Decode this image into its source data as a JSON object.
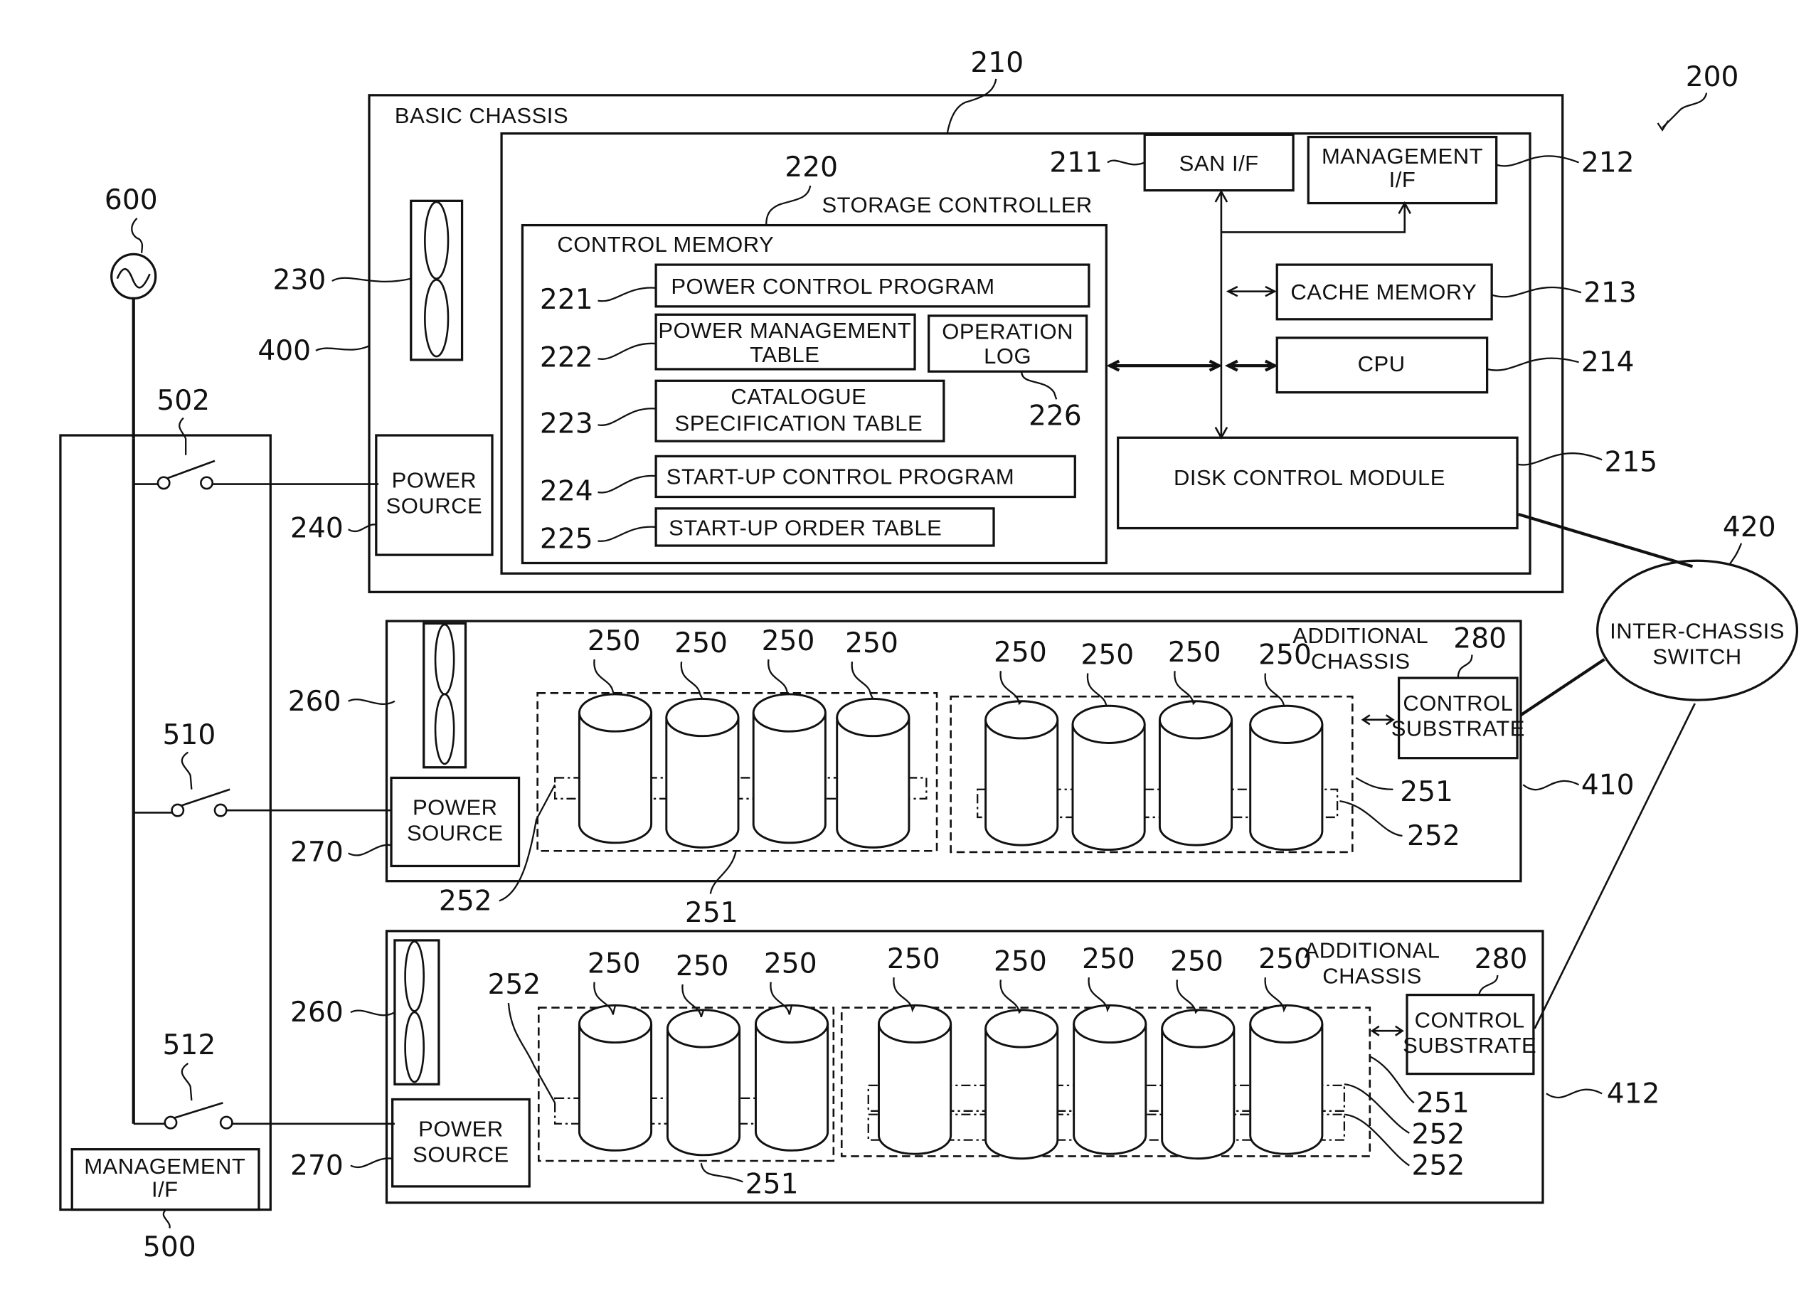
{
  "figure": {
    "system_ref": "200",
    "basic_chassis": {
      "title": "BASIC CHASSIS",
      "ref": "400",
      "fan_ref": "230",
      "power_source_label": [
        "POWER",
        "SOURCE"
      ],
      "power_source_ref": "240",
      "storage_controller": {
        "title": "STORAGE CONTROLLER",
        "ref": "210",
        "san_if": {
          "label": "SAN I/F",
          "ref": "211"
        },
        "management_if": {
          "label": [
            "MANAGEMENT",
            "I/F"
          ],
          "ref": "212"
        },
        "cache_memory": {
          "label": "CACHE MEMORY",
          "ref": "213"
        },
        "cpu": {
          "label": "CPU",
          "ref": "214"
        },
        "disk_control_module": {
          "label": "DISK CONTROL MODULE",
          "ref": "215"
        },
        "control_memory": {
          "title": "CONTROL MEMORY",
          "ref": "220",
          "items": [
            {
              "ref": "221",
              "label": [
                "POWER CONTROL PROGRAM"
              ]
            },
            {
              "ref": "222",
              "label": [
                "POWER MANAGEMENT",
                "TABLE"
              ]
            },
            {
              "ref": "223",
              "label": [
                "CATALOGUE",
                "SPECIFICATION TABLE"
              ]
            },
            {
              "ref": "224",
              "label": [
                "START-UP CONTROL PROGRAM"
              ]
            },
            {
              "ref": "225",
              "label": [
                "START-UP ORDER TABLE"
              ]
            },
            {
              "ref": "226",
              "label": [
                "OPERATION",
                "LOG"
              ]
            }
          ]
        }
      }
    },
    "additional_chassis": [
      {
        "ref": "410",
        "title": [
          "ADDITIONAL",
          "CHASSIS"
        ],
        "fan_ref": "260",
        "power_source_label": [
          "POWER",
          "SOURCE"
        ],
        "power_source_ref": "270",
        "control_substrate": {
          "label": [
            "CONTROL",
            "SUBSTRATE"
          ],
          "ref": "280"
        },
        "disk_ref": "250",
        "raid_group_ref": "251",
        "logical_volume_ref": "252",
        "groups": [
          {
            "disks": 4
          },
          {
            "disks": 4
          }
        ]
      },
      {
        "ref": "412",
        "title": [
          "ADDITIONAL",
          "CHASSIS"
        ],
        "fan_ref": "260",
        "power_source_label": [
          "POWER",
          "SOURCE"
        ],
        "power_source_ref": "270",
        "control_substrate": {
          "label": [
            "CONTROL",
            "SUBSTRATE"
          ],
          "ref": "280"
        },
        "disk_ref": "250",
        "raid_group_ref": "251",
        "logical_volume_ref": "252",
        "groups": [
          {
            "disks": 3
          },
          {
            "disks": 5
          }
        ]
      }
    ],
    "inter_chassis_switch": {
      "label": [
        "INTER-CHASSIS",
        "SWITCH"
      ],
      "ref": "420"
    },
    "power_management": {
      "ac_source_ref": "600",
      "switches": [
        "502",
        "510",
        "512"
      ],
      "management_if": {
        "label": [
          "MANAGEMENT",
          "I/F"
        ],
        "ref": "500"
      }
    }
  }
}
